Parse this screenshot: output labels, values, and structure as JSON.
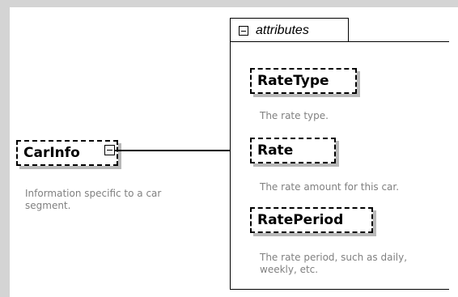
{
  "diagram": {
    "root": {
      "name": "CarInfo",
      "description": "Information specific to a car segment."
    },
    "group": {
      "label": "attributes"
    },
    "attributes": [
      {
        "name": "RateType",
        "description": "The rate type."
      },
      {
        "name": "Rate",
        "description": "The rate amount for this car."
      },
      {
        "name": "RatePeriod",
        "description": "The rate period, such as daily, weekly, etc."
      }
    ]
  },
  "icons": {
    "collapse": "minus-box-icon"
  }
}
